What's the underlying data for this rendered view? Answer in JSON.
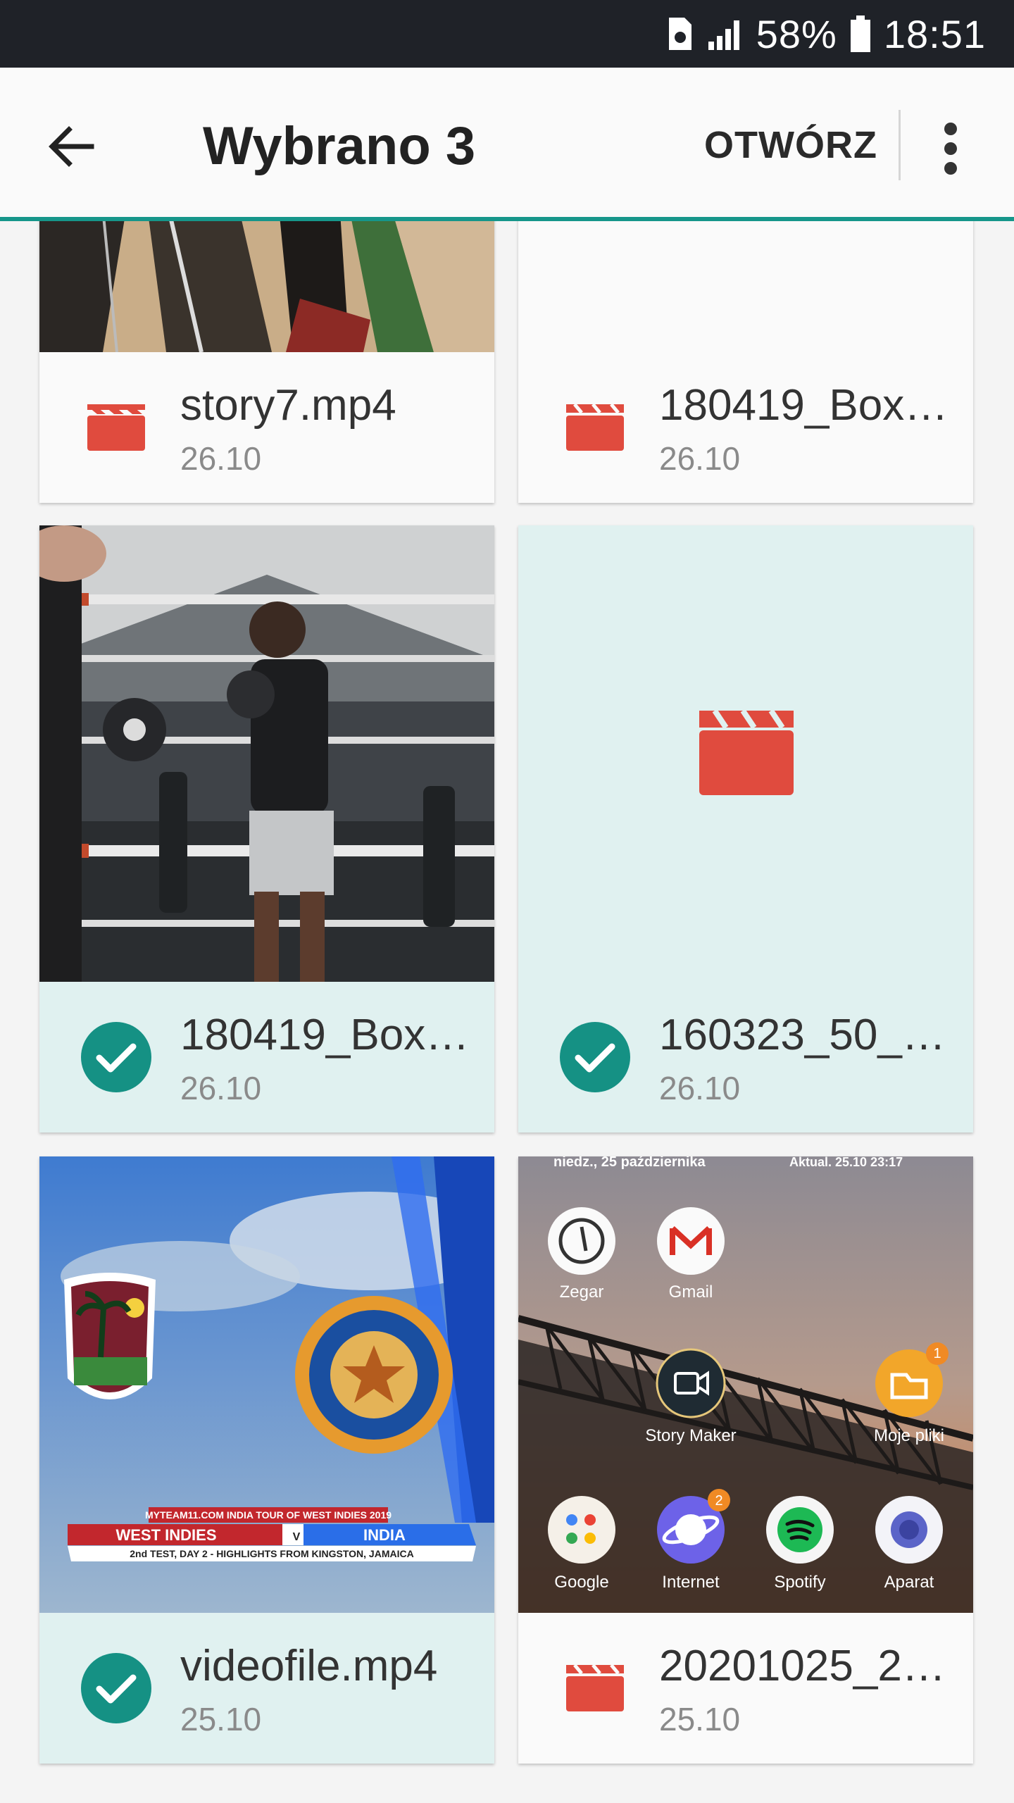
{
  "status_bar": {
    "battery": "58%",
    "time": "18:51",
    "icons": [
      "sim-card-icon",
      "signal-icon",
      "battery-icon"
    ]
  },
  "app_bar": {
    "title": "Wybrano 3",
    "open_label": "OTWÓRZ",
    "back_icon": "arrow-left-icon",
    "more_icon": "more-vert-icon"
  },
  "colors": {
    "accent": "#16968a",
    "video_icon": "#e04b3e",
    "selected_bg": "#e0f1f0",
    "check": "#159184"
  },
  "files": [
    {
      "name": "story7.mp4",
      "date": "26.10",
      "selected": false,
      "thumbnail": "darts-board"
    },
    {
      "name": "180419_Box…",
      "date": "26.10",
      "selected": false,
      "thumbnail": "blank"
    },
    {
      "name": "180419_Box…",
      "date": "26.10",
      "selected": true,
      "thumbnail": "boxing-gym"
    },
    {
      "name": "160323_50_…",
      "date": "26.10",
      "selected": true,
      "thumbnail": "video-placeholder"
    },
    {
      "name": "videofile.mp4",
      "date": "25.10",
      "selected": true,
      "thumbnail": "cricket-west-indies-india"
    },
    {
      "name": "20201025_2…",
      "date": "25.10",
      "selected": false,
      "thumbnail": "phone-homescreen"
    }
  ],
  "thumb_text": {
    "cricket": {
      "banner": "MYTEAM11.COM INDIA TOUR OF WEST INDIES 2019",
      "team_left": "WEST INDIES",
      "versus": "V",
      "team_right": "INDIA",
      "subtitle": "2nd TEST, DAY 2 - HIGHLIGHTS FROM KINGSTON, JAMAICA"
    },
    "homescreen": {
      "top_left": "niedz., 25 października",
      "top_right": "Aktual. 25.10 23:17",
      "apps_row1": [
        "Zegar",
        "Gmail"
      ],
      "apps_row2": [
        "Story Maker",
        "Moje pliki"
      ],
      "apps_row3": [
        "Google",
        "Internet",
        "Spotify",
        "Aparat"
      ],
      "badge_files": "1",
      "badge_internet": "2"
    }
  }
}
